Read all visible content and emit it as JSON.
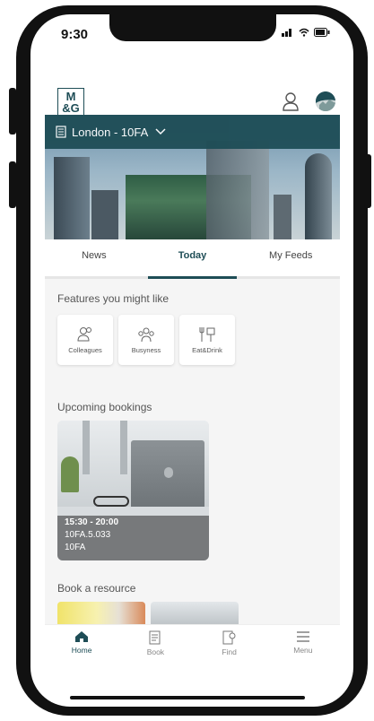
{
  "status": {
    "time": "9:30"
  },
  "header": {
    "logo_top": "M",
    "logo_bottom": "&G"
  },
  "location": {
    "label": "London - 10FA"
  },
  "tabs": [
    {
      "label": "News",
      "active": false
    },
    {
      "label": "Today",
      "active": true
    },
    {
      "label": "My Feeds",
      "active": false
    }
  ],
  "features": {
    "title": "Features you might like",
    "items": [
      {
        "label": "Colleagues",
        "icon": "people-icon"
      },
      {
        "label": "Busyness",
        "icon": "crowd-icon"
      },
      {
        "label": "Eat&Drink",
        "icon": "cutlery-icon"
      }
    ]
  },
  "bookings": {
    "title": "Upcoming bookings",
    "items": [
      {
        "time": "15:30 - 20:00",
        "room": "10FA.5.033",
        "building": "10FA"
      }
    ]
  },
  "resources": {
    "title": "Book a resource"
  },
  "bottom_nav": [
    {
      "label": "Home",
      "icon": "home-icon",
      "active": true
    },
    {
      "label": "Book",
      "icon": "book-icon",
      "active": false
    },
    {
      "label": "Find",
      "icon": "find-icon",
      "active": false
    },
    {
      "label": "Menu",
      "icon": "menu-icon",
      "active": false
    }
  ],
  "colors": {
    "brand": "#1e4d56",
    "background": "#f5f5f5"
  }
}
